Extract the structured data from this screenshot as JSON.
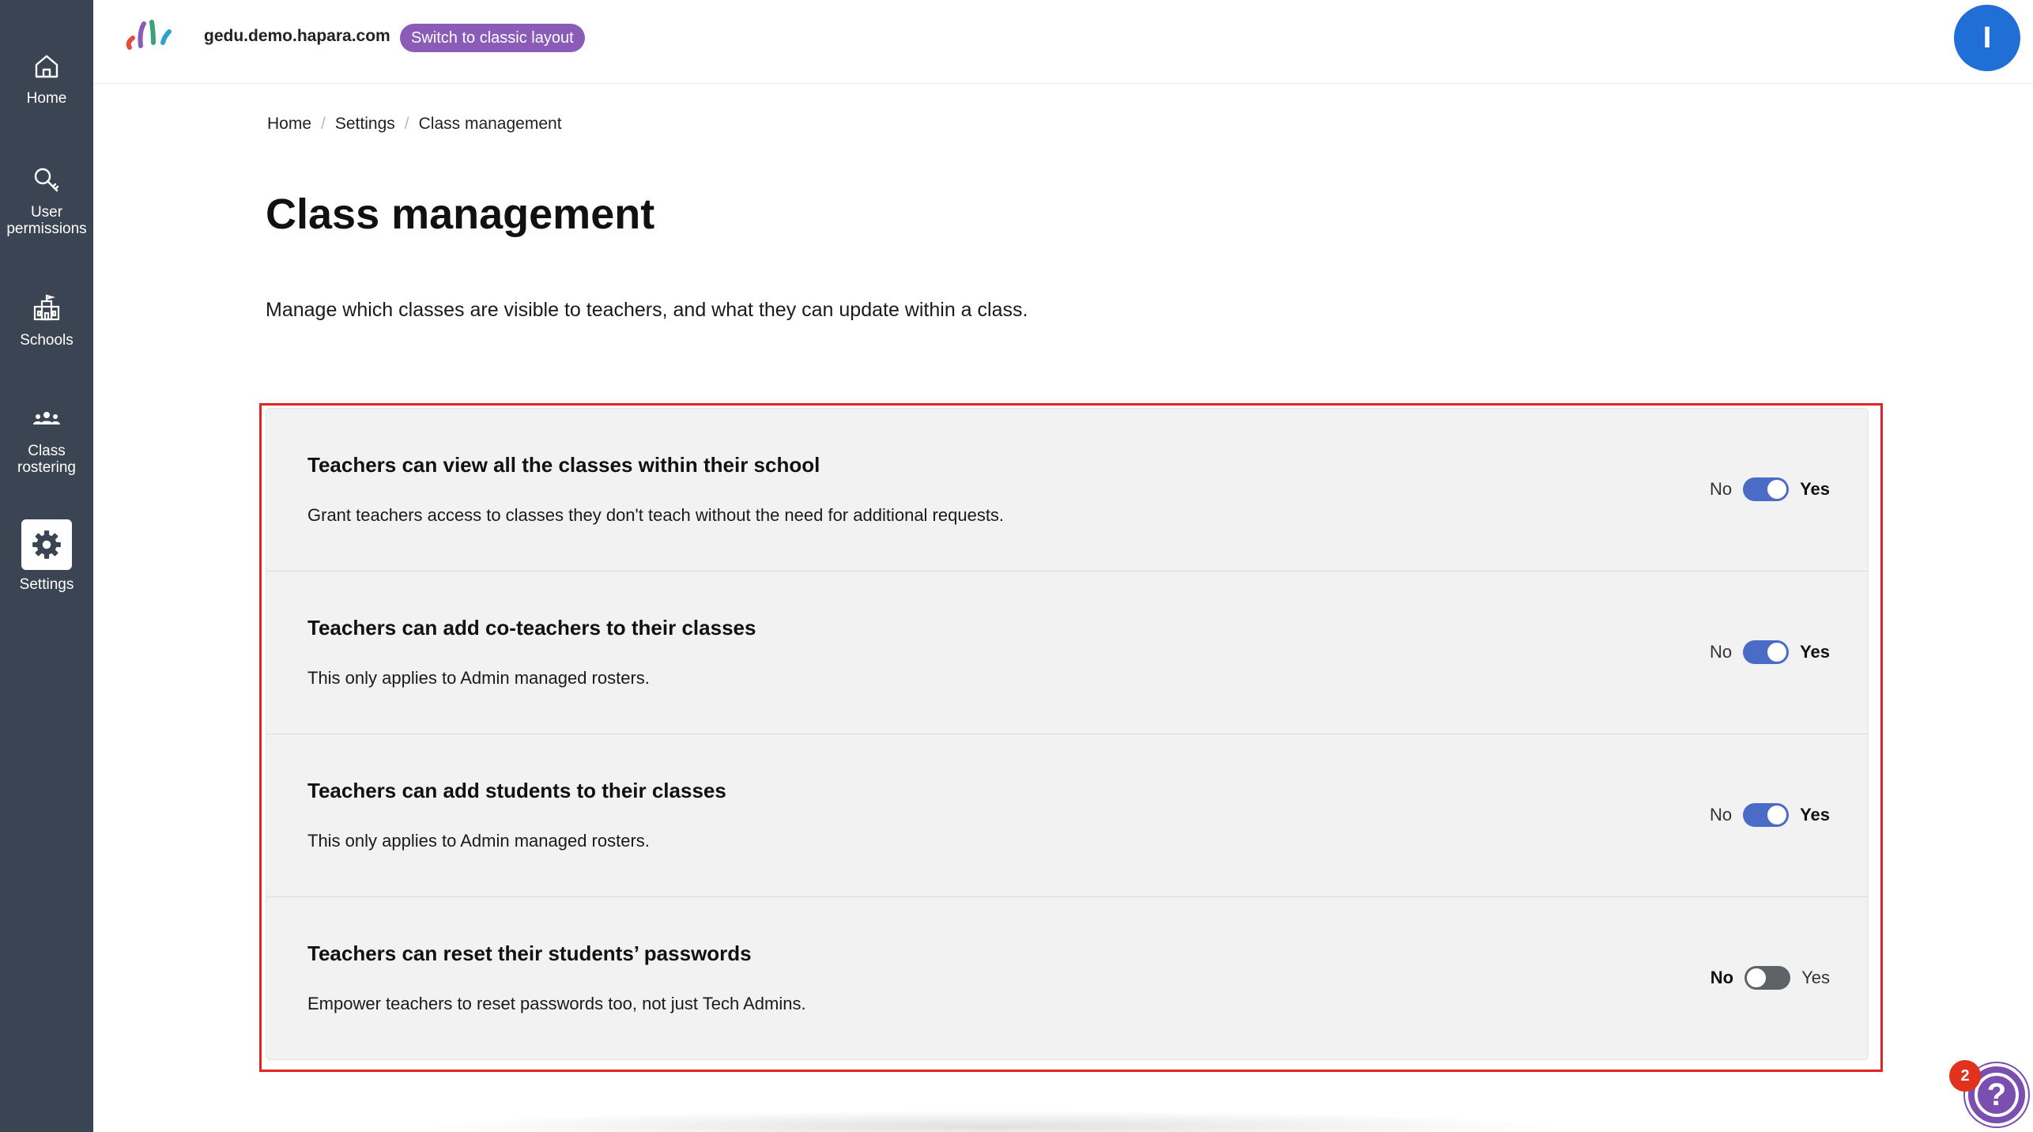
{
  "sidebar": {
    "items": [
      {
        "label": "Home",
        "icon": "home-icon"
      },
      {
        "label": "User\npermissions",
        "icon": "key-icon"
      },
      {
        "label": "Schools",
        "icon": "school-icon"
      },
      {
        "label": "Class\nrostering",
        "icon": "people-icon"
      },
      {
        "label": "Settings",
        "icon": "gear-icon",
        "active": true
      }
    ]
  },
  "header": {
    "domain": "gedu.demo.hapara.com",
    "classic_button": "Switch to classic layout",
    "avatar_initial": "I"
  },
  "breadcrumb": [
    "Home",
    "Settings",
    "Class management"
  ],
  "page": {
    "title": "Class management",
    "description": "Manage which classes are visible to teachers, and what they can update within a class."
  },
  "settings": [
    {
      "title": "Teachers can view all the classes within their school",
      "description": "Grant teachers access to classes they don't teach without the need for additional requests.",
      "no_label": "No",
      "yes_label": "Yes",
      "enabled": true
    },
    {
      "title": "Teachers can add co-teachers to their classes",
      "description": "This only applies to Admin managed rosters.",
      "no_label": "No",
      "yes_label": "Yes",
      "enabled": true
    },
    {
      "title": "Teachers can add students to their classes",
      "description": "This only applies to Admin managed rosters.",
      "no_label": "No",
      "yes_label": "Yes",
      "enabled": true
    },
    {
      "title": "Teachers can reset their students’ passwords",
      "description": "Empower teachers to reset passwords too, not just Tech Admins.",
      "no_label": "No",
      "yes_label": "Yes",
      "enabled": false
    }
  ],
  "help": {
    "badge_count": "2",
    "icon": "help-icon"
  },
  "colors": {
    "sidebar_bg": "#3b4452",
    "accent": "#8a5cb8",
    "toggle_on": "#4a6cc7",
    "highlight": "#e02424"
  }
}
